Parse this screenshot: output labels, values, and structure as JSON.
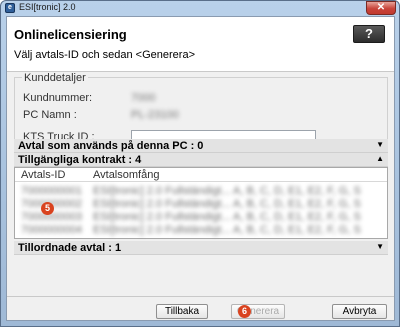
{
  "window": {
    "title": "ESI[tronic] 2.0",
    "close_symbol": "✕"
  },
  "header": {
    "title": "Onlinelicensiering",
    "subtitle": "Välj avtals-ID och sedan <Generera>",
    "help_label": "?"
  },
  "customer": {
    "legend": "Kunddetaljer",
    "customer_number_label": "Kundnummer:",
    "pc_name_label": "PC Namn :",
    "kts_truck_id_label": "KTS Truck ID :",
    "customer_number_value": "7000",
    "pc_name_value": "PL-23100",
    "kts_truck_id_value": ""
  },
  "sections": {
    "pc_agreements": "Avtal som används på denna PC : 0",
    "available_contracts": "Tillgängliga kontrakt : 4",
    "assigned": "Tillordnade avtal : 1"
  },
  "table": {
    "columns": [
      "Avtals-ID",
      "Avtalsomfång"
    ],
    "rows": [
      {
        "id": "7000000001",
        "scope": "ESI[tronic] 2.0 Fullständigt... A, B, C, D, E1, E2, F, G, S"
      },
      {
        "id": "7000000002",
        "scope": "ESI[tronic] 2.0 Fullständigt... A, B, C, D, E1, E2, F, G, S"
      },
      {
        "id": "7000000003",
        "scope": "ESI[tronic] 2.0 Fullständigt... A, B, C, D, E1, E2, F, G, S"
      },
      {
        "id": "7000000004",
        "scope": "ESI[tronic] 2.0 Fullständigt... A, B, C, D, E1, E2, F, G, S"
      }
    ]
  },
  "badges": {
    "table_badge": "5",
    "generate_badge": "6"
  },
  "buttons": {
    "back": "Tillbaka",
    "generate": "Generera",
    "cancel": "Avbryta"
  }
}
